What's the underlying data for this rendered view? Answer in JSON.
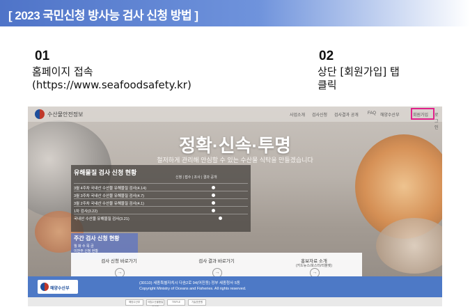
{
  "banner": {
    "title": "[ 2023 국민신청 방사능 검사 신청 방법 ]"
  },
  "steps": [
    {
      "number": "01",
      "text": "홈페이지 접속\n(https://www.seafoodsafety.kr)"
    },
    {
      "number": "02",
      "text": "상단 [회원가입] 탭\n클릭"
    }
  ],
  "site": {
    "logo_text": "수산물안전정보",
    "nav": [
      "사업소개",
      "검사신청",
      "검사결과 공개",
      "FAQ",
      "해양수산부",
      "회원가입",
      "로그인"
    ],
    "hero_title": "정확·신속·투명",
    "hero_sub": "철저하게 관리해 안심할 수 있는 수산물 식탁을 만들겠습니다",
    "panel_title": "유해물질 검사 신청 현황",
    "panel_cols": "신청 | 접수 | 조사 | 결과 공개",
    "panel_rows": [
      "3월 4주차 국내산 수산물 유해물질 검사(4.14)",
      "3월 3주차 국내산 수산물 유해물질 검사(4.7)",
      "3월 2주차 국내산 수산물 유해물질 검사(4.1)",
      "1차 검사(3.22)",
      "국내산 수산물 유해물질 검사(3.21)"
    ],
    "panel2_title": "주간 검사 신청 현황",
    "panel2_body": "월 화 수 목 금\n이번주 신청 현황",
    "cards": [
      {
        "label": "검사 신청 바로가기",
        "sub": ""
      },
      {
        "label": "검사 결과 바로가기",
        "sub": ""
      },
      {
        "label": "홍보자료 소개",
        "sub": "(카드뉴스/포스터/리플렛)"
      }
    ],
    "footer_logo": "해양수산부",
    "footer_lines": [
      "(30110) 세종특별자치시 다솜2로 94(어진동) 정부 세종청사 5동",
      "Copyright Ministry of Oceans and Fisheries. All rights reserved."
    ],
    "bottom_links": [
      "해양수산부",
      "국립수산물품질관리원",
      "TRIPLE",
      "기술표준원"
    ]
  }
}
